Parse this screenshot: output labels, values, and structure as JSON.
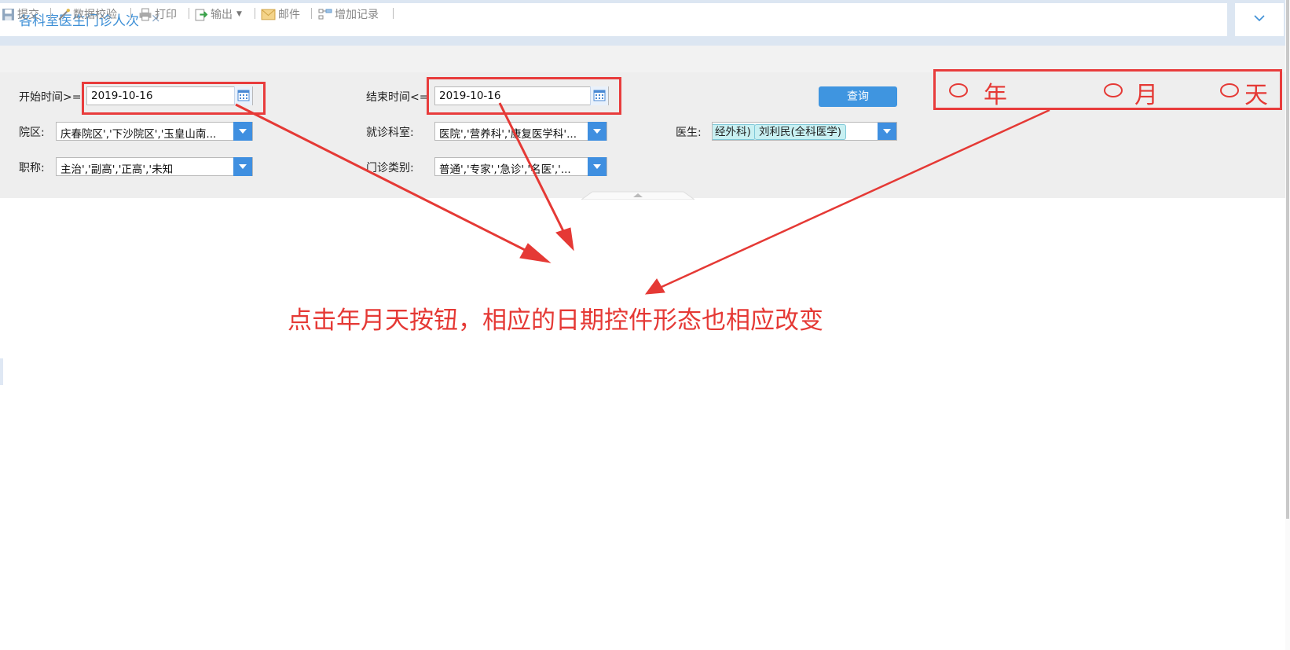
{
  "tabs": [
    {
      "label": "各科室医生门诊人次",
      "close": "×"
    }
  ],
  "toolbar": {
    "submit": "提交",
    "validate": "数据校验",
    "print": "打印",
    "export": "输出",
    "mail": "邮件",
    "add_record": "增加记录"
  },
  "filters": {
    "start_label": "开始时间>=",
    "start_value": "2019-10-16",
    "end_label": "结束时间<=",
    "end_value": "2019-10-16",
    "campus_label": "院区:",
    "campus_value": "庆春院区','下沙院区','玉皇山南...",
    "dept_label": "就诊科室:",
    "dept_value": "医院','营养科','康复医学科'...",
    "doctor_label": "医生:",
    "doctor_tags": [
      "经外科)",
      "刘利民(全科医学)"
    ],
    "title_label": "职称:",
    "title_value": "主治','副高','正高','未知",
    "clinic_label": "门诊类别:",
    "clinic_value": "普通','专家','急诊','名医','...",
    "query_button": "查询"
  },
  "radios": {
    "year": "年",
    "month": "月",
    "day": "天"
  },
  "annotation": "点击年月天按钮，相应的日期控件形态也相应改变",
  "colors": {
    "accent": "#3f95e0",
    "annotation_red": "#e53935",
    "tab_text": "#3d8fd6"
  }
}
